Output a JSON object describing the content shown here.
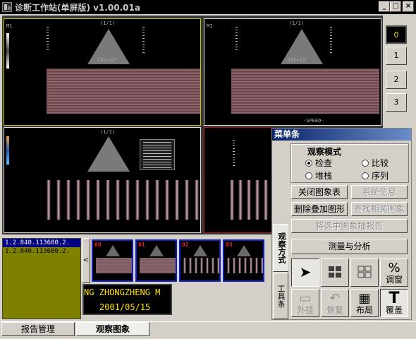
{
  "window": {
    "title": "诊断工作站(单屏版) v1.00.01a",
    "min": "_",
    "max": "□",
    "close": "×"
  },
  "viewer": {
    "pane_top_label": "(1/1)",
    "pane_calib": "CAL=12\"",
    "pane_corner": "M1",
    "pane_bottom": "-SPEED-"
  },
  "frame_buttons": [
    "0",
    "1",
    "2",
    "3"
  ],
  "menu": {
    "title": "菜单条",
    "tabs": [
      "观察方式",
      "工具条"
    ],
    "mode_group": {
      "title": "观察模式",
      "options": [
        {
          "label": "检查",
          "checked": true
        },
        {
          "label": "比较",
          "checked": false
        },
        {
          "label": "堆栈",
          "checked": false
        },
        {
          "label": "序列",
          "checked": false
        }
      ]
    },
    "buttons": {
      "close_table": "关闭图象表",
      "system_info": "系统信息",
      "delete_overlay": "删除叠加图形",
      "find_related": "查找相关图象",
      "insert_report": "将选中图象插报告",
      "measure": "测量与分析"
    },
    "tools": [
      {
        "label": "",
        "icon": "pointer-icon"
      },
      {
        "label": "",
        "icon": "grid-layout-icon"
      },
      {
        "label": "",
        "icon": "grid-outline-icon"
      },
      {
        "label": "调窗",
        "icon": "window-level-icon"
      },
      {
        "label": "外挂",
        "icon": "external-icon"
      },
      {
        "label": "恢复",
        "icon": "restore-icon"
      },
      {
        "label": "布局",
        "icon": "layout-icon"
      },
      {
        "label": "覆盖",
        "icon": "overlay-icon"
      }
    ]
  },
  "series_list": [
    "1.2.840.113680.2.",
    "1.2.840.113680.2."
  ],
  "thumbnails": [
    "00",
    "01",
    "02",
    "03"
  ],
  "strip_arrow": "<",
  "patient": {
    "name": "NG ZHONGZHENG M",
    "date": "2001/05/15"
  },
  "bottom_tabs": [
    "报告管理",
    "观察图象"
  ]
}
